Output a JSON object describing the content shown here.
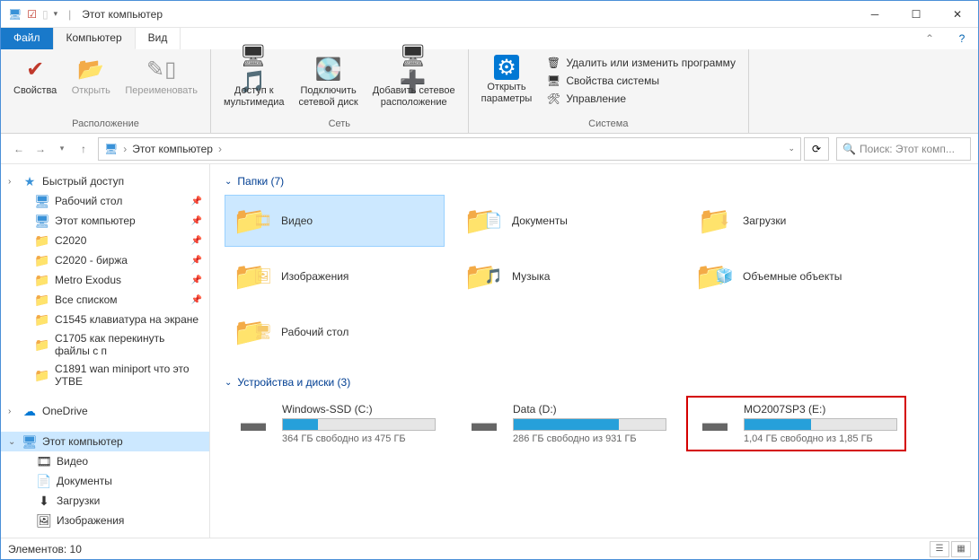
{
  "title": "Этот компьютер",
  "menu": {
    "file": "Файл",
    "computer": "Компьютер",
    "view": "Вид"
  },
  "ribbon": {
    "properties": "Свойства",
    "open": "Открыть",
    "rename": "Переименовать",
    "group_location": "Расположение",
    "media_access": "Доступ к\nмультимедиа",
    "connect_drive": "Подключить\nсетевой диск",
    "add_net_location": "Добавить сетевое\nрасположение",
    "group_network": "Сеть",
    "open_params": "Открыть\nпараметры",
    "sys_delete": "Удалить или изменить программу",
    "sys_props": "Свойства системы",
    "sys_manage": "Управление",
    "group_system": "Система"
  },
  "address": {
    "root": "Этот компьютер"
  },
  "search": {
    "placeholder": "Поиск: Этот комп..."
  },
  "sidebar": {
    "quick_access": "Быстрый доступ",
    "items": [
      {
        "label": "Рабочий стол"
      },
      {
        "label": "Этот компьютер"
      },
      {
        "label": "C2020"
      },
      {
        "label": "C2020 - биржа"
      },
      {
        "label": "Metro Exodus"
      },
      {
        "label": "Все списком"
      },
      {
        "label": "C1545 клавиатура на экране"
      },
      {
        "label": "C1705 как перекинуть файлы с п"
      },
      {
        "label": "C1891 wan miniport что это УТВЕ"
      }
    ],
    "onedrive": "OneDrive",
    "this_pc": "Этот компьютер",
    "pc_children": [
      {
        "label": "Видео"
      },
      {
        "label": "Документы"
      },
      {
        "label": "Загрузки"
      },
      {
        "label": "Изображения"
      }
    ]
  },
  "folders_section": "Папки (7)",
  "folders": [
    {
      "name": "Видео",
      "selected": true
    },
    {
      "name": "Документы"
    },
    {
      "name": "Загрузки"
    },
    {
      "name": "Изображения"
    },
    {
      "name": "Музыка"
    },
    {
      "name": "Объемные объекты"
    },
    {
      "name": "Рабочий стол"
    }
  ],
  "drives_section": "Устройства и диски (3)",
  "drives": [
    {
      "name": "Windows-SSD (C:)",
      "free": "364 ГБ свободно из 475 ГБ",
      "fill": 23
    },
    {
      "name": "Data (D:)",
      "free": "286 ГБ свободно из 931 ГБ",
      "fill": 69
    },
    {
      "name": "MO2007SP3 (E:)",
      "free": "1,04 ГБ свободно из 1,85 ГБ",
      "fill": 44,
      "highlighted": true
    }
  ],
  "status": {
    "count": "Элементов: 10"
  }
}
